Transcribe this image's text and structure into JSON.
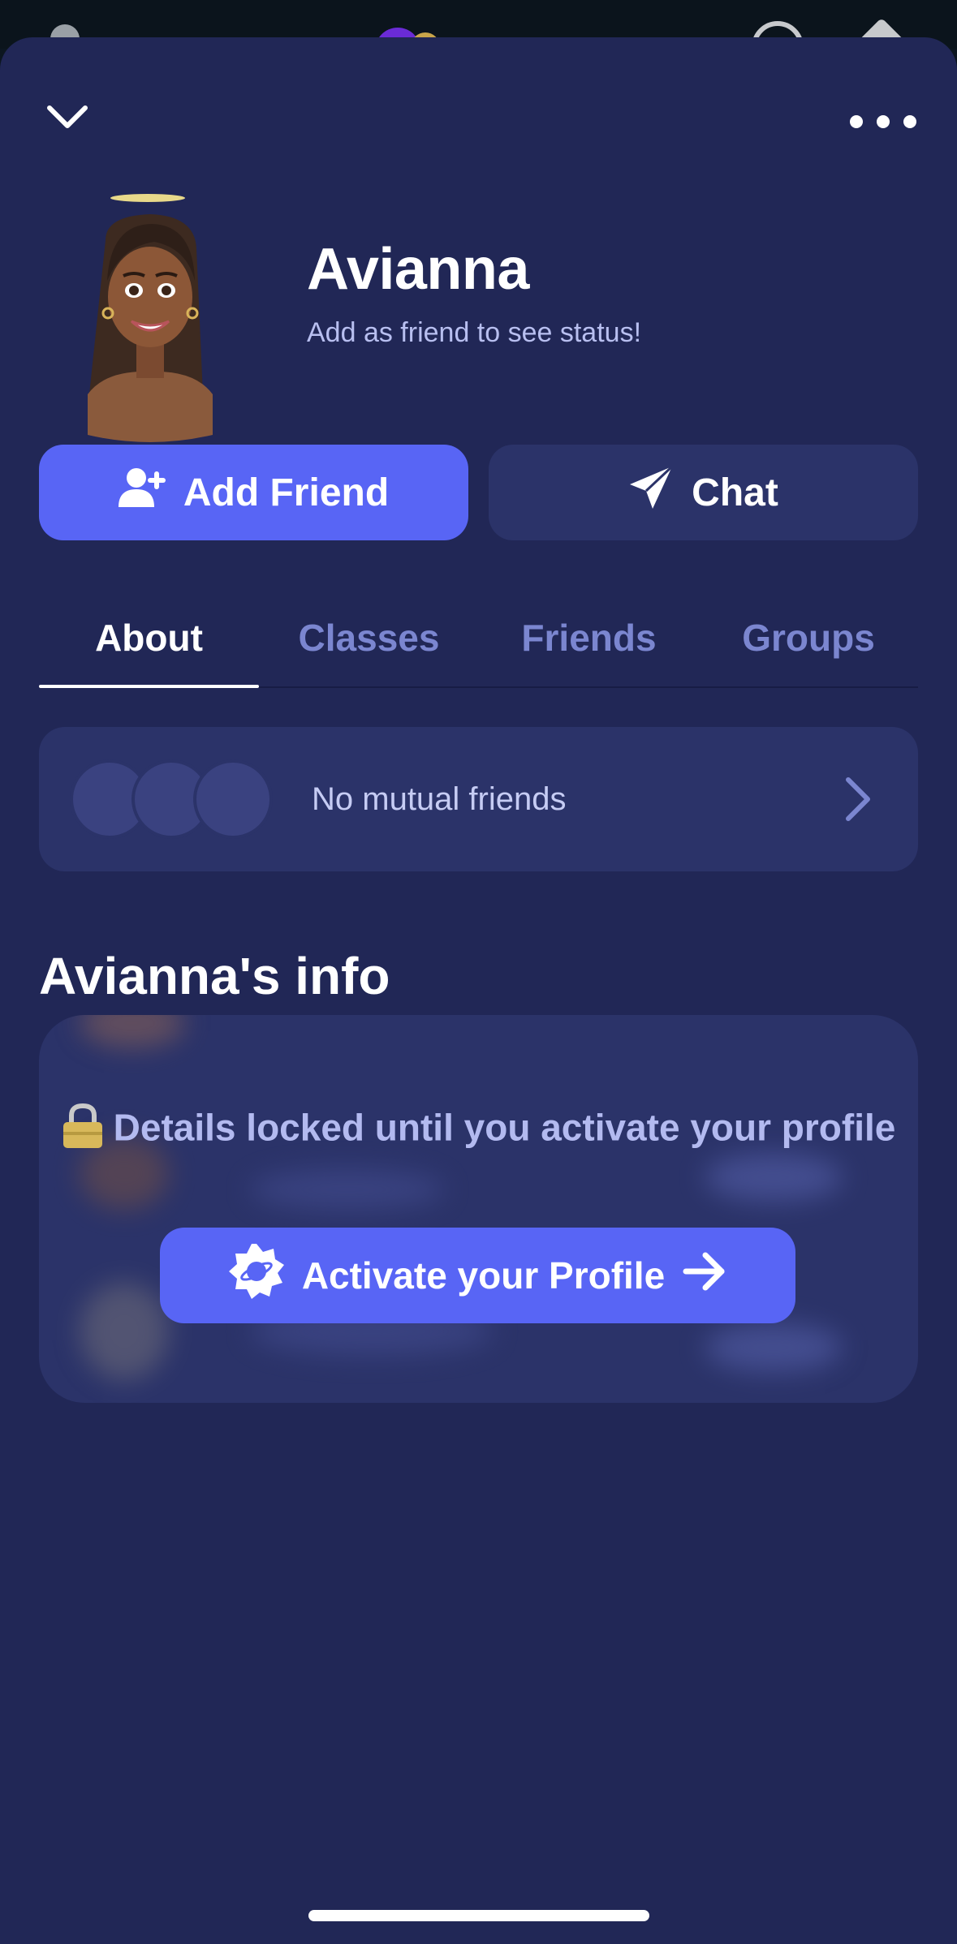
{
  "profile": {
    "name": "Avianna",
    "status": "Add as friend to see status!"
  },
  "actions": {
    "add_friend_label": "Add Friend",
    "chat_label": "Chat"
  },
  "tabs": [
    {
      "label": "About",
      "active": true
    },
    {
      "label": "Classes",
      "active": false
    },
    {
      "label": "Friends",
      "active": false
    },
    {
      "label": "Groups",
      "active": false
    }
  ],
  "mutual": {
    "text": "No mutual friends"
  },
  "info": {
    "title": "Avianna's info",
    "locked_text": "Details locked until you activate your profile",
    "activate_label": "Activate your Profile"
  },
  "icons": {
    "collapse": "chevron-down-icon",
    "more": "more-options-icon",
    "add_friend": "user-plus-icon",
    "chat": "paper-plane-icon",
    "mutual_arrow": "chevron-right-icon",
    "lock": "lock-icon",
    "activate": "planet-badge-icon",
    "arrow": "arrow-right-icon"
  },
  "colors": {
    "background": "#212756",
    "card": "#2b3369",
    "accent": "#5865f5",
    "tab_inactive": "#7b86d0"
  }
}
